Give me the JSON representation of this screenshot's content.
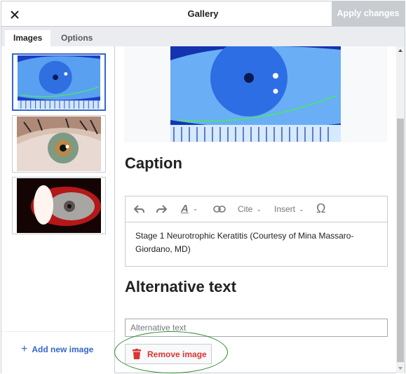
{
  "dialog": {
    "title": "Gallery",
    "apply_label": "Apply changes",
    "close_icon": "close-icon"
  },
  "tabs": [
    {
      "label": "Images",
      "active": true
    },
    {
      "label": "Options",
      "active": false
    }
  ],
  "sidebar": {
    "thumbnails": [
      {
        "description": "blue fluorescein-stained eye",
        "selected": true
      },
      {
        "description": "hazel eye close-up",
        "selected": false
      },
      {
        "description": "eye under red slit-lamp light",
        "selected": false
      }
    ],
    "add_label": "Add new image",
    "add_icon": "plus-icon"
  },
  "main": {
    "preview_description": "blue fluorescein-stained eye",
    "caption_heading": "Caption",
    "toolbar": {
      "undo_icon": "undo-icon",
      "redo_icon": "redo-icon",
      "text_style_icon": "text-style-icon",
      "link_icon": "link-icon",
      "cite_label": "Cite",
      "insert_label": "Insert",
      "special_char_icon": "omega-icon"
    },
    "caption_text": "Stage 1 Neurotrophic Keratitis (Courtesy of Mina Massaro-Giordano, MD)",
    "alt_heading": "Alternative text",
    "alt_value": "",
    "alt_placeholder": "Alternative text",
    "remove_label": "Remove image",
    "remove_icon": "trash-icon"
  },
  "colors": {
    "accent": "#3366cc",
    "destructive": "#dd3333",
    "disabled_button": "#c8ccd1",
    "annotation": "#2e8b2e"
  }
}
